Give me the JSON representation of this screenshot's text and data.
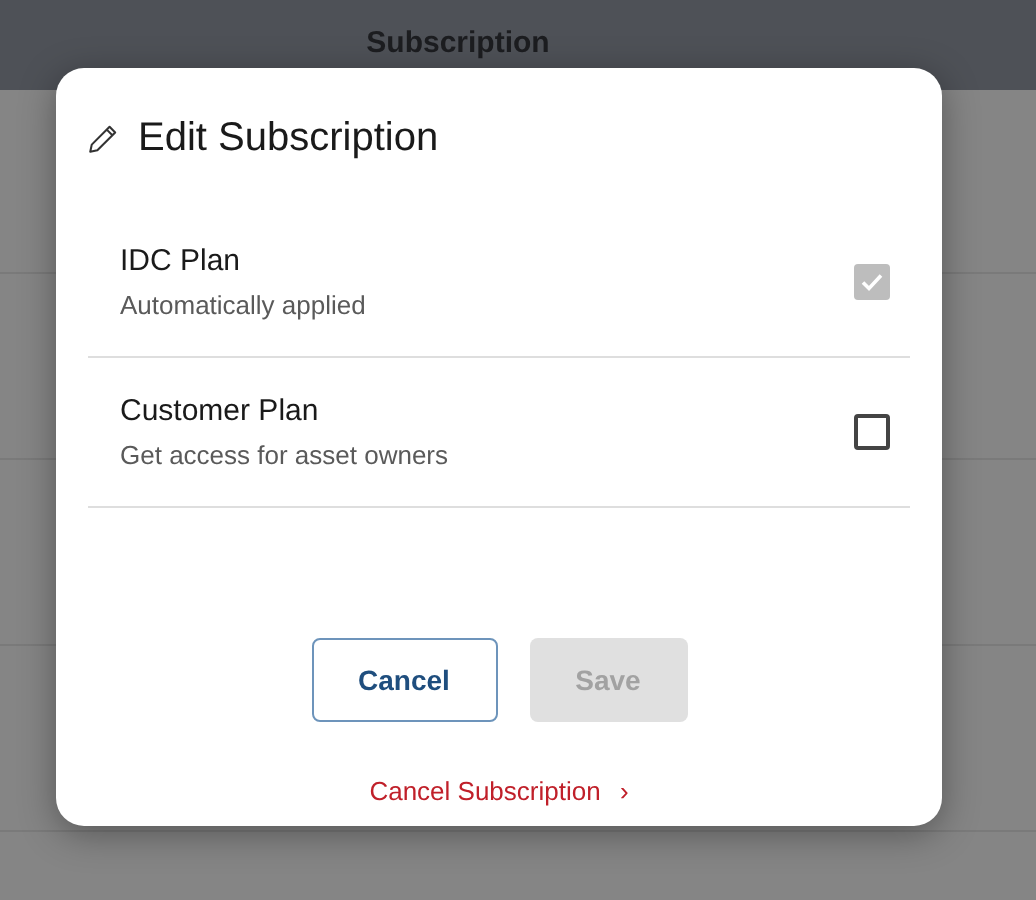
{
  "page": {
    "header": "Subscription"
  },
  "dialog": {
    "title": "Edit Subscription",
    "plans": [
      {
        "name": "IDC Plan",
        "description": "Automatically applied",
        "checked": true,
        "disabled": true
      },
      {
        "name": "Customer Plan",
        "description": "Get access for asset owners",
        "checked": false,
        "disabled": false
      }
    ],
    "buttons": [
      {
        "label": "Cancel",
        "kind": "secondary",
        "disabled": false
      },
      {
        "label": "Save",
        "kind": "primary",
        "disabled": true
      }
    ],
    "link": {
      "label": "Cancel Subscription",
      "chevron": "›"
    }
  }
}
